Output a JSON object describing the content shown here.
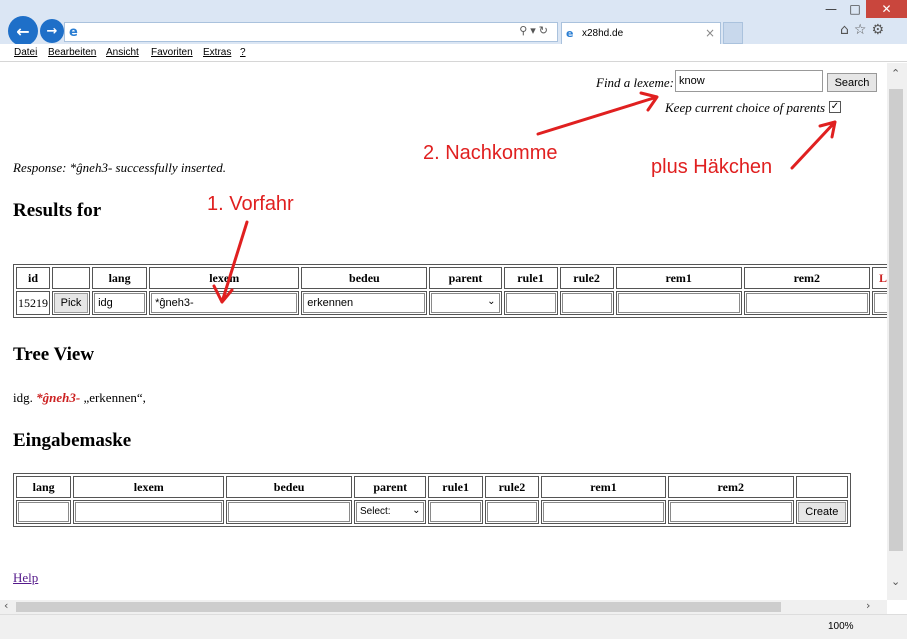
{
  "browser": {
    "tab_label": "x28hd.de",
    "zoom": "100%",
    "menu": [
      "Datei",
      "Bearbeiten",
      "Ansicht",
      "Favoriten",
      "Extras",
      "?"
    ]
  },
  "search": {
    "label": "Find a lexeme:",
    "value": "know",
    "button": "Search",
    "keep_label": "Keep current choice of parents",
    "keep_checked": "✓"
  },
  "response": "Response: *ĝneh3- successfully inserted.",
  "results": {
    "heading": "Results for",
    "columns": [
      "id",
      "",
      "lang",
      "lexem",
      "bedeu",
      "parent",
      "rule1",
      "rule2",
      "rem1",
      "rem2",
      "La"
    ],
    "row": {
      "id": "15219",
      "pick": "Pick",
      "lang": "idg",
      "lexem": "*ĝneh3-",
      "bedeu": "erkennen"
    }
  },
  "tree": {
    "heading": "Tree View",
    "lang": "idg.",
    "lexeme": "*ĝneh3-",
    "gloss": "„erkennen“,"
  },
  "form": {
    "heading": "Eingabemaske",
    "columns": [
      "lang",
      "lexem",
      "bedeu",
      "parent",
      "rule1",
      "rule2",
      "rem1",
      "rem2",
      ""
    ],
    "parent_select": "Select:",
    "create_button": "Create"
  },
  "help_link": "Help",
  "annotations": {
    "ancestor": "1. Vorfahr",
    "descendant": "2. Nachkomme",
    "checkmark": "plus Häkchen",
    "color": "#e02020"
  }
}
